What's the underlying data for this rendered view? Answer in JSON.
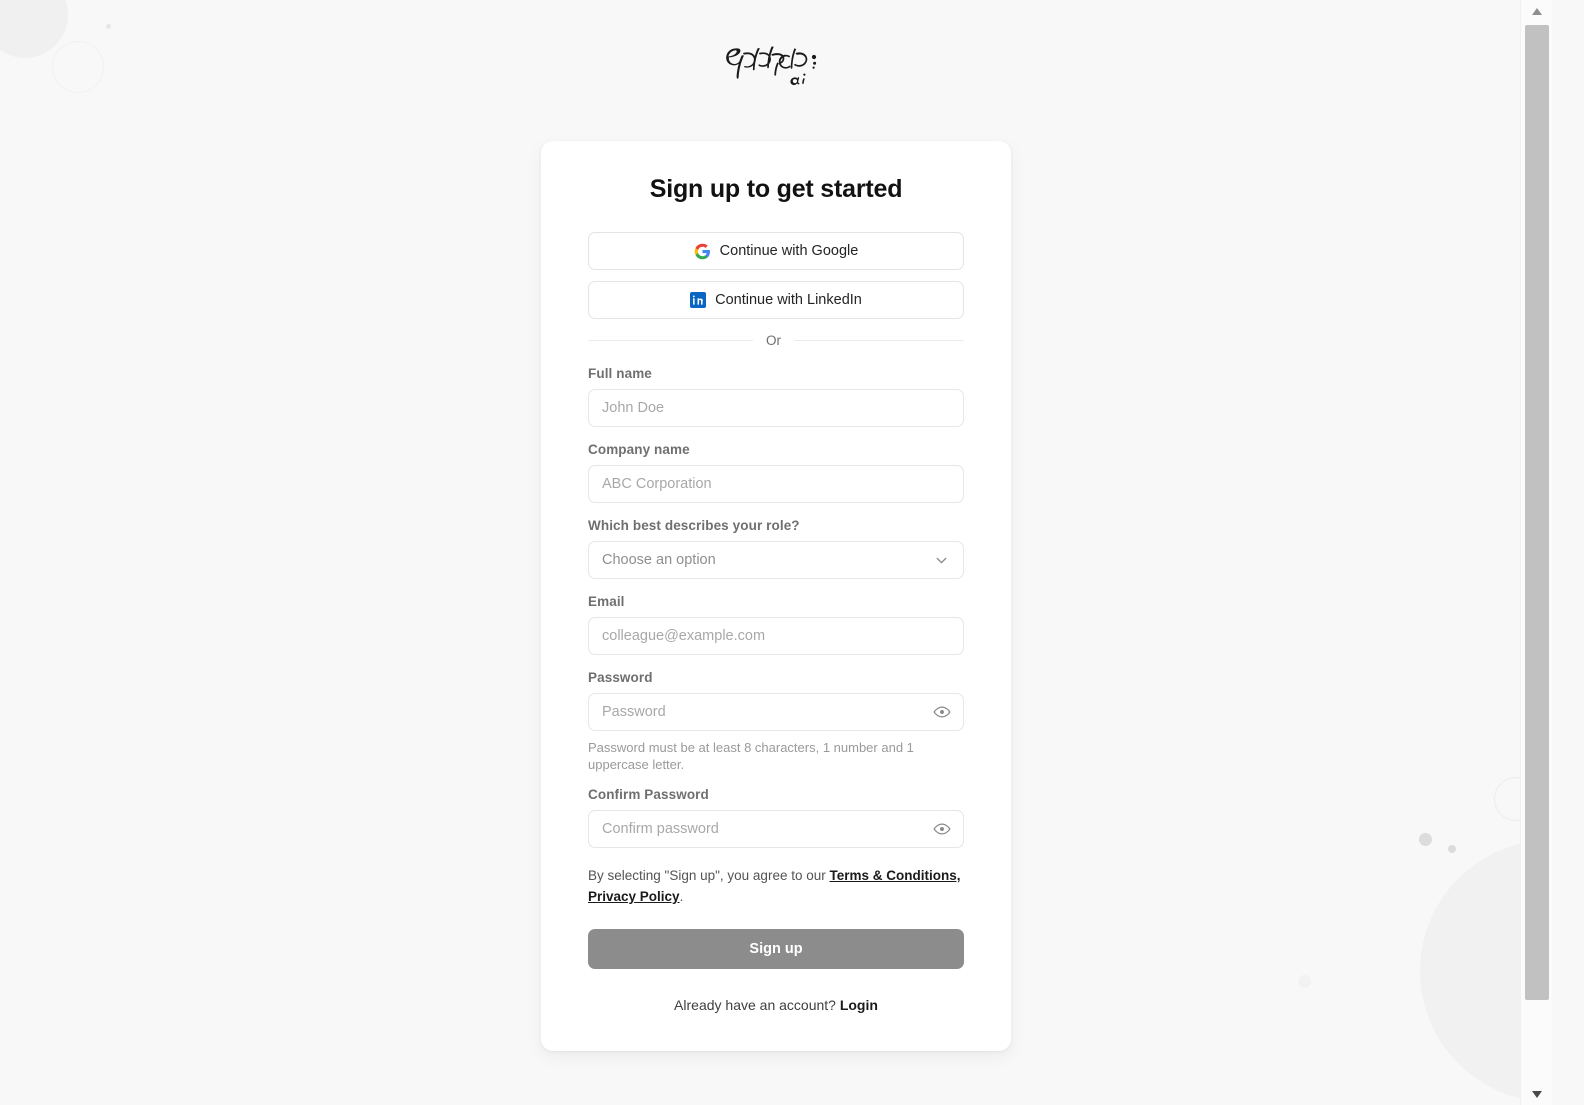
{
  "brand": {
    "logo_text": "Epipheo",
    "logo_sub": "ai",
    "logo_icon": "epipheo-wordmark"
  },
  "card": {
    "title": "Sign up to get started"
  },
  "oauth": {
    "google": {
      "label": "Continue with Google",
      "icon": "google-icon"
    },
    "linkedin": {
      "label": "Continue with LinkedIn",
      "icon": "linkedin-icon"
    }
  },
  "divider": {
    "label": "Or"
  },
  "form": {
    "full_name": {
      "label": "Full name",
      "placeholder": "John Doe",
      "value": ""
    },
    "company_name": {
      "label": "Company name",
      "placeholder": "ABC Corporation",
      "value": ""
    },
    "role": {
      "label": "Which best describes your role?",
      "selected": "Choose an option",
      "icon": "chevron-down-icon"
    },
    "email": {
      "label": "Email",
      "placeholder": "colleague@example.com",
      "value": ""
    },
    "password": {
      "label": "Password",
      "placeholder": "Password",
      "value": "",
      "toggle_icon": "eye-icon",
      "help": "Password must be at least 8 characters, 1 number and 1 uppercase letter."
    },
    "confirm_password": {
      "label": "Confirm Password",
      "placeholder": "Confirm password",
      "value": "",
      "toggle_icon": "eye-icon"
    }
  },
  "terms": {
    "prefix": "By selecting \"Sign up\", you agree to our ",
    "link_terms": "Terms & Conditions,",
    "separator": " ",
    "link_privacy": "Privacy Policy",
    "suffix": "."
  },
  "submit": {
    "label": "Sign up",
    "enabled": false
  },
  "footer": {
    "prompt": "Already have an account? ",
    "login_label": "Login"
  },
  "colors": {
    "page_background": "#f8f8f8",
    "card_background": "#ffffff",
    "submit_disabled": "#8c8c8c",
    "border": "#e6e6e6",
    "label_text": "#6f6f6f",
    "placeholder_text": "#a8a8a8",
    "google_blue": "#4285f4",
    "google_red": "#ea4335",
    "google_yellow": "#fbbc05",
    "google_green": "#34a853",
    "linkedin_blue": "#0a66c2"
  },
  "scrollbar": {
    "visible": true,
    "up_icon": "caret-up-icon",
    "down_icon": "caret-down-icon"
  }
}
